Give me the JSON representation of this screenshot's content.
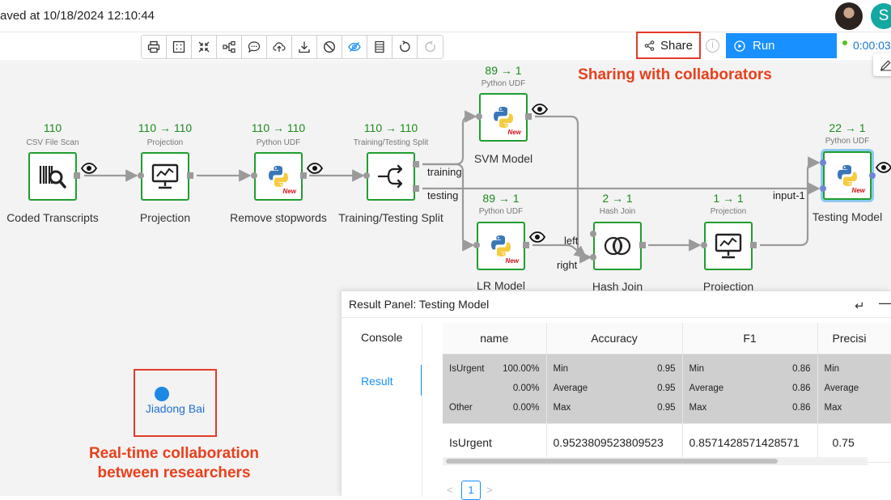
{
  "header": {
    "saved_text": "aved at 10/18/2024 12:10:44",
    "user_initial": "S"
  },
  "toolbar": {
    "tool_icons": [
      "print-icon",
      "grid-icon",
      "fit-screen-icon",
      "layout-icon",
      "comment-icon",
      "upload-icon",
      "download-icon",
      "disable-icon",
      "hide-icon",
      "results-icon",
      "undo-icon",
      "redo-icon"
    ],
    "share_label": "Share",
    "info_label": "i",
    "run_label": "Run",
    "timer": "0:00:03"
  },
  "canvas": {
    "operators": [
      {
        "id": "coded",
        "count": "110",
        "type": "CSV File Scan",
        "name": "Coded Transcripts"
      },
      {
        "id": "proj1",
        "count": "110 → 110",
        "type": "Projection",
        "name": "Projection"
      },
      {
        "id": "stop",
        "count": "110 → 110",
        "type": "Python UDF",
        "name": "Remove stopwords"
      },
      {
        "id": "split",
        "count": "110 → 110",
        "type": "Training/Testing Split",
        "name": "Training/Testing Split"
      },
      {
        "id": "svm",
        "count": "89 → 1",
        "type": "Python UDF",
        "name": "SVM Model"
      },
      {
        "id": "lr",
        "count": "89 → 1",
        "type": "Python UDF",
        "name": "LR Model"
      },
      {
        "id": "hash",
        "count": "2 → 1",
        "type": "Hash Join",
        "name": "Hash Join"
      },
      {
        "id": "proj2",
        "count": "1 → 1",
        "type": "Projection",
        "name": "Projection"
      },
      {
        "id": "test",
        "count": "22 → 1",
        "type": "Python UDF",
        "name": "Testing Model"
      }
    ],
    "port_labels": {
      "training": "training",
      "testing": "testing",
      "left": "left",
      "right": "right",
      "input": "input-1"
    },
    "new_badge": "New"
  },
  "annotations": {
    "sharing": "Sharing with collaborators",
    "realtime_line1": "Real-time collaboration",
    "realtime_line2": "between researchers",
    "collaborator_name": "Jiadong Bai"
  },
  "result_panel": {
    "title": "Result Panel: Testing Model",
    "tabs": {
      "console": "Console",
      "result": "Result"
    },
    "columns": [
      "name",
      "Accuracy",
      "F1",
      "Precisi"
    ],
    "stats": {
      "name_col": [
        {
          "label": "IsUrgent",
          "value": "100.00%"
        },
        {
          "label": "",
          "value": "0.00%"
        },
        {
          "label": "Other",
          "value": "0.00%"
        }
      ],
      "accuracy": [
        {
          "label": "Min",
          "value": "0.95"
        },
        {
          "label": "Average",
          "value": "0.95"
        },
        {
          "label": "Max",
          "value": "0.95"
        }
      ],
      "f1": [
        {
          "label": "Min",
          "value": "0.86"
        },
        {
          "label": "Average",
          "value": "0.86"
        },
        {
          "label": "Max",
          "value": "0.86"
        }
      ],
      "precision": [
        {
          "label": "Min",
          "value": ""
        },
        {
          "label": "Average",
          "value": ""
        },
        {
          "label": "Max",
          "value": ""
        }
      ]
    },
    "row": {
      "name": "IsUrgent",
      "accuracy": "0.9523809523809523",
      "f1": "0.8571428571428571",
      "precision": "0.75"
    },
    "pagination": {
      "prev": "<",
      "page": "1",
      "next": ">"
    }
  }
}
